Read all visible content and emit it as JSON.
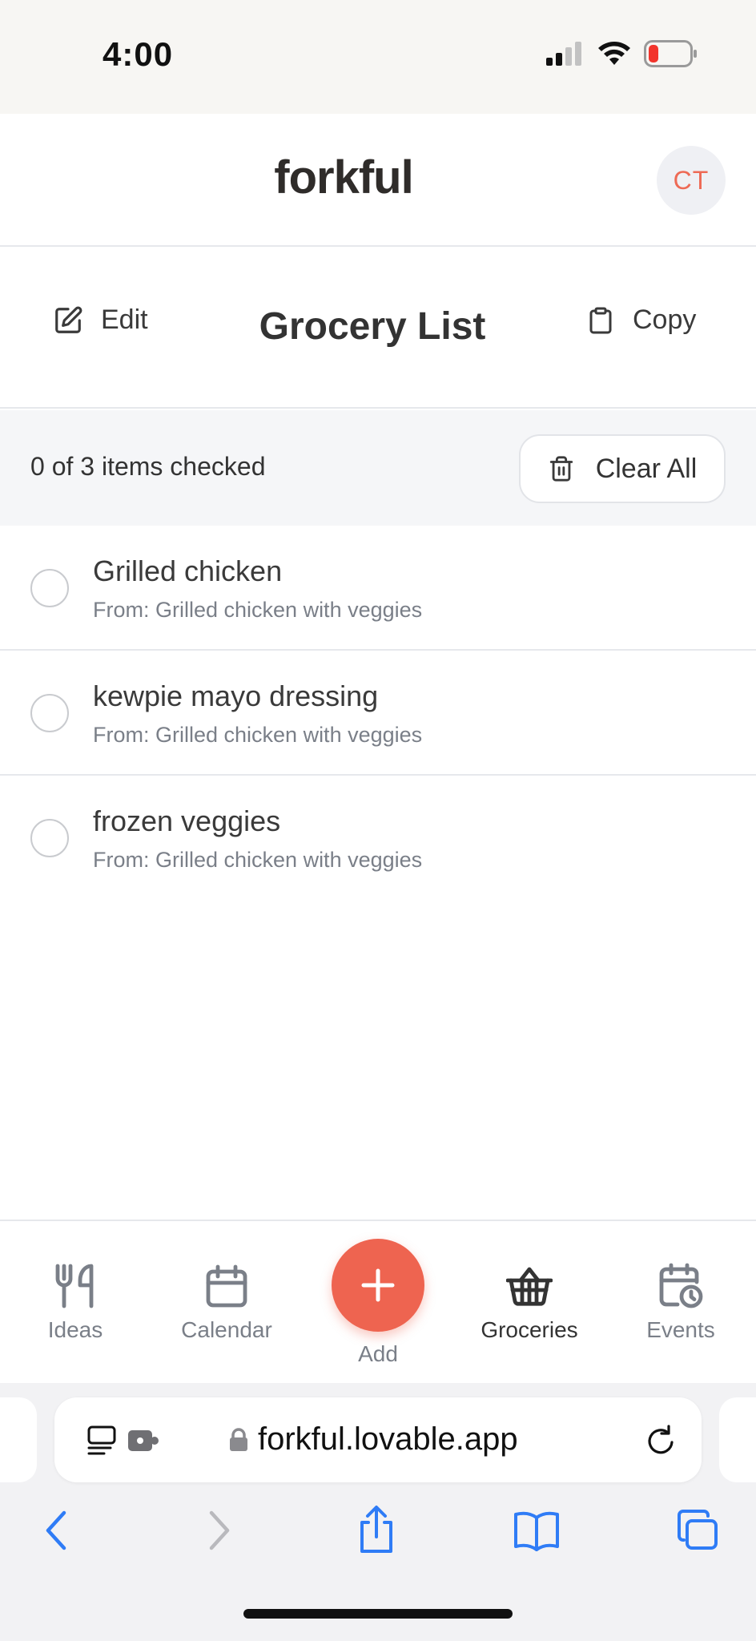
{
  "status_bar": {
    "time": "4:00"
  },
  "header": {
    "logo": "forkful",
    "avatar_initials": "CT"
  },
  "toolbar": {
    "edit_label": "Edit",
    "title": "Grocery List",
    "copy_label": "Copy"
  },
  "summary": {
    "checked_text": "0 of 3 items checked",
    "clear_label": "Clear All"
  },
  "items": [
    {
      "name": "Grilled chicken",
      "source": "From: Grilled chicken with veggies",
      "checked": false
    },
    {
      "name": "kewpie mayo dressing",
      "source": "From: Grilled chicken with veggies",
      "checked": false
    },
    {
      "name": "frozen veggies",
      "source": "From: Grilled chicken with veggies",
      "checked": false
    }
  ],
  "nav": {
    "ideas": "Ideas",
    "calendar": "Calendar",
    "add": "Add",
    "groceries": "Groceries",
    "events": "Events",
    "active": "groceries"
  },
  "browser": {
    "url": "forkful.lovable.app"
  },
  "colors": {
    "accent": "#ee6450",
    "text": "#3a3a3a",
    "muted": "#7a7f88",
    "divider": "#e6e8ec",
    "link_blue": "#2f7cf6"
  },
  "icons": {
    "edit": "pencil-square-icon",
    "copy": "clipboard-icon",
    "clear": "trash-icon",
    "ideas": "fork-knife-icon",
    "calendar": "calendar-icon",
    "add": "plus-icon",
    "groceries": "basket-icon",
    "events": "calendar-clock-icon"
  }
}
